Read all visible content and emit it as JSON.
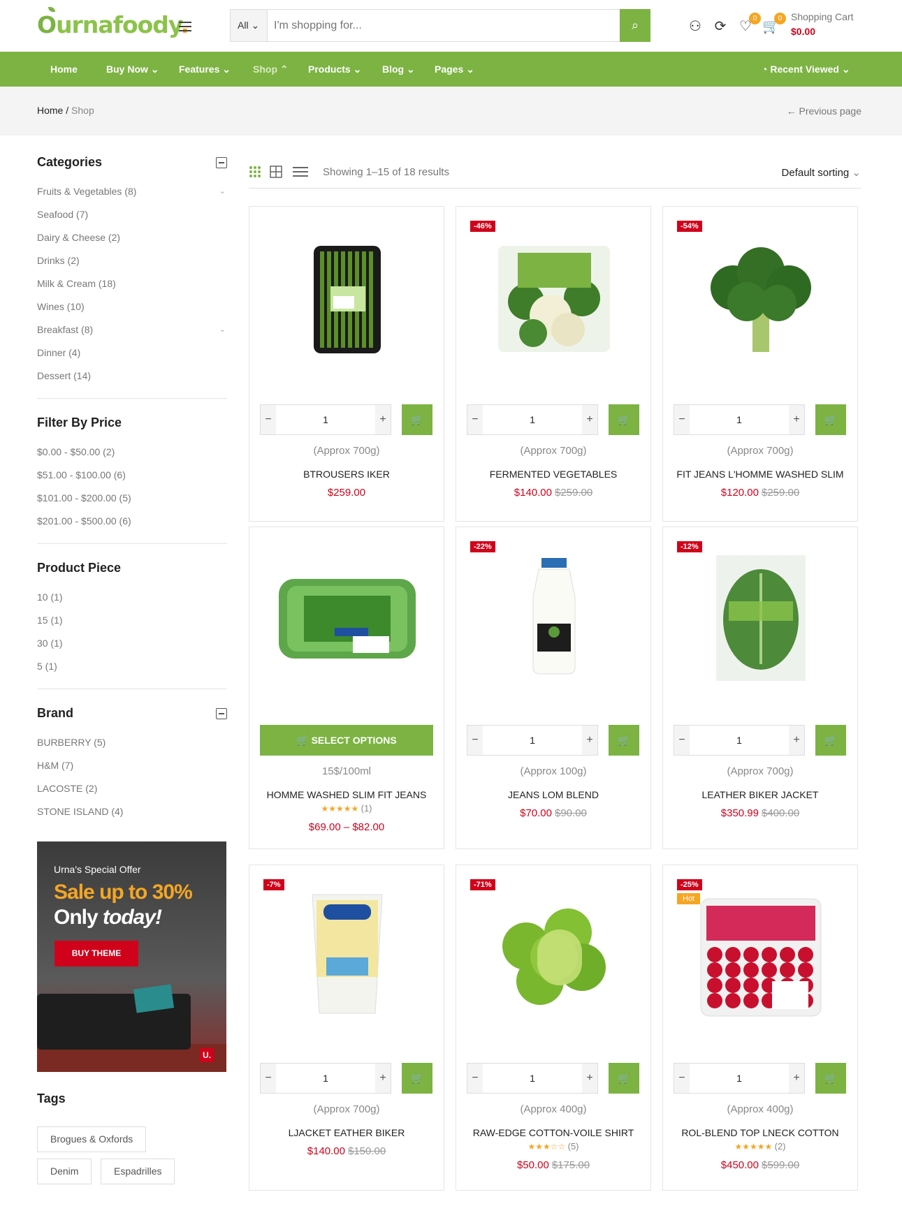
{
  "brand": {
    "logo_o": "O",
    "logo_rest": "urnafoody",
    "logo_dot": "."
  },
  "search": {
    "category": "All",
    "placeholder": "I'm shopping for..."
  },
  "header": {
    "compare_count": "0",
    "wishlist_count": "0",
    "cart_label": "Shopping Cart",
    "cart_total": "$0.00"
  },
  "nav": {
    "items": [
      "Home",
      "Buy Now",
      "Features",
      "Shop",
      "Products",
      "Blog",
      "Pages"
    ],
    "recent": "Recent Viewed"
  },
  "breadcrumb": {
    "home": "Home",
    "separator": "/",
    "current": "Shop",
    "previous": "Previous page"
  },
  "sidebar": {
    "categories_title": "Categories",
    "categories": [
      "Fruits & Vegetables (8)",
      "Seafood (7)",
      "Dairy & Cheese (2)",
      "Drinks (2)",
      "Milk & Cream (18)",
      "Wines (10)",
      "Breakfast (8)",
      "Dinner (4)",
      "Dessert (14)"
    ],
    "price_title": "Filter By Price",
    "prices": [
      "$0.00 - $50.00 (2)",
      "$51.00 - $100.00 (6)",
      "$101.00 - $200.00 (5)",
      "$201.00 - $500.00 (6)"
    ],
    "piece_title": "Product Piece",
    "pieces": [
      "10 (1)",
      "15 (1)",
      "30 (1)",
      "5 (1)"
    ],
    "brand_title": "Brand",
    "brands": [
      "BURBERRY (5)",
      "H&M (7)",
      "LACOSTE (2)",
      "STONE ISLAND (4)"
    ],
    "promo": {
      "line1": "Urna's Special Offer",
      "line2a": "Sale ",
      "line2b": "up to 30%",
      "line3a": "Only ",
      "line3b": "today!",
      "button": "BUY THEME",
      "logo": "U."
    },
    "tags_title": "Tags",
    "tags": [
      "Brogues & Oxfords",
      "Denim",
      "Espadrilles"
    ]
  },
  "toolbar": {
    "showing": "Showing 1–15 of 18 results",
    "sorting": "Default sorting"
  },
  "products": [
    {
      "badge": "",
      "hot": "",
      "weight": "(Approx 700g)",
      "name": "BTROUSERS IKER",
      "price": "$259.00",
      "old": "",
      "qty": "1",
      "image": "asparagus",
      "select": ""
    },
    {
      "badge": "-46%",
      "hot": "",
      "weight": "(Approx 700g)",
      "name": "FERMENTED VEGETABLES",
      "price": "$140.00",
      "old": "$259.00",
      "qty": "1",
      "image": "cauliflower-broccoli",
      "select": ""
    },
    {
      "badge": "-54%",
      "hot": "",
      "weight": "(Approx 700g)",
      "name": "FIT JEANS L'HOMME WASHED SLIM",
      "price": "$120.00",
      "old": "$259.00",
      "qty": "1",
      "image": "broccoli",
      "select": ""
    },
    {
      "badge": "",
      "hot": "",
      "weight": "15$/100ml",
      "name": "HOMME WASHED SLIM FIT JEANS",
      "price": "$69.00 – $82.00",
      "old": "",
      "qty": "",
      "image": "eggs",
      "select": "SELECT OPTIONS",
      "stars": "★★★★★",
      "count": "(1)"
    },
    {
      "badge": "-22%",
      "hot": "",
      "weight": "(Approx 100g)",
      "name": "JEANS LOM BLEND",
      "price": "$70.00",
      "old": "$90.00",
      "qty": "1",
      "image": "milk",
      "select": ""
    },
    {
      "badge": "-12%",
      "hot": "",
      "weight": "(Approx 700g)",
      "name": "LEATHER BIKER JACKET",
      "price": "$350.99",
      "old": "$400.00",
      "qty": "1",
      "image": "cabbage",
      "select": ""
    },
    {
      "badge": "-7%",
      "hot": "",
      "weight": "(Approx 700g)",
      "name": "LJACKET EATHER BIKER",
      "price": "$140.00",
      "old": "$150.00",
      "qty": "1",
      "image": "buttermilk",
      "select": ""
    },
    {
      "badge": "-71%",
      "hot": "",
      "weight": "(Approx 400g)",
      "name": "RAW-EDGE COTTON-VOILE SHIRT",
      "price": "$50.00",
      "old": "$175.00",
      "qty": "1",
      "image": "limes",
      "select": "",
      "stars": "★★★☆☆",
      "count": "(5)"
    },
    {
      "badge": "-25%",
      "hot": "Hot",
      "weight": "(Approx 400g)",
      "name": "ROL-BLEND TOP LNECK COTTON",
      "price": "$450.00",
      "old": "$599.00",
      "qty": "1",
      "image": "raspberries",
      "select": "",
      "stars": "★★★★★",
      "count": "(2)"
    }
  ],
  "colors": {
    "accent": "#7cb342",
    "sale": "#d0021b",
    "badge": "#f5a623"
  }
}
